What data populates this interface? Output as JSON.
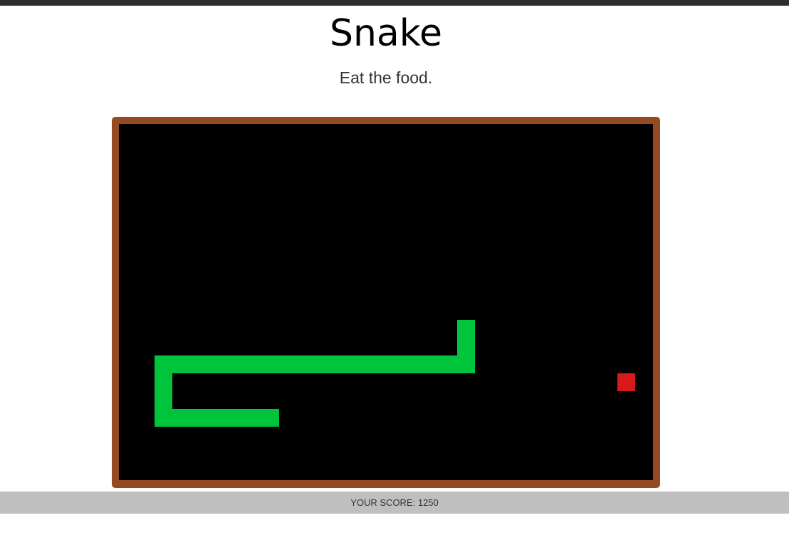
{
  "header": {
    "title": "Snake",
    "subtitle": "Eat the food."
  },
  "game": {
    "grid": {
      "cols": 30,
      "rows": 20
    },
    "snake": [
      [
        19,
        11
      ],
      [
        19,
        12
      ],
      [
        19,
        13
      ],
      [
        18,
        13
      ],
      [
        17,
        13
      ],
      [
        16,
        13
      ],
      [
        15,
        13
      ],
      [
        14,
        13
      ],
      [
        13,
        13
      ],
      [
        12,
        13
      ],
      [
        11,
        13
      ],
      [
        10,
        13
      ],
      [
        9,
        13
      ],
      [
        8,
        13
      ],
      [
        7,
        13
      ],
      [
        6,
        13
      ],
      [
        5,
        13
      ],
      [
        4,
        13
      ],
      [
        3,
        13
      ],
      [
        2,
        13
      ],
      [
        2,
        14
      ],
      [
        2,
        15
      ],
      [
        2,
        16
      ],
      [
        3,
        16
      ],
      [
        4,
        16
      ],
      [
        5,
        16
      ],
      [
        6,
        16
      ],
      [
        7,
        16
      ],
      [
        8,
        16
      ]
    ],
    "food": [
      28,
      14
    ],
    "colors": {
      "snake": "#00c43b",
      "food": "#d71919",
      "board": "#000000",
      "frame": "#954a22"
    }
  },
  "footer": {
    "score_label": "YOUR SCORE: 1250"
  }
}
